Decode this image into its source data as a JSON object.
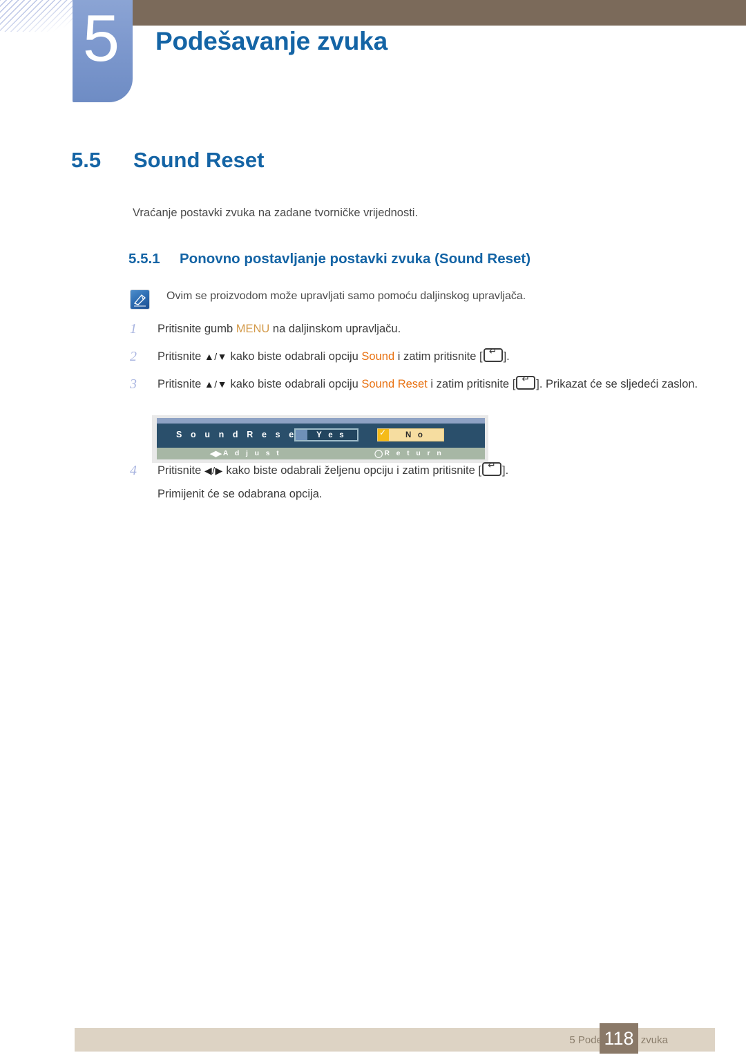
{
  "header": {
    "chapter_number": "5",
    "chapter_title": "Podešavanje zvuka"
  },
  "section": {
    "number": "5.5",
    "title": "Sound Reset",
    "description": "Vraćanje postavki zvuka na zadane tvorničke vrijednosti."
  },
  "subsection": {
    "number": "5.5.1",
    "title": "Ponovno postavljanje postavki zvuka (Sound Reset)"
  },
  "note": {
    "icon": "note-pen-icon",
    "text": "Ovim se proizvodom može upravljati samo pomoću daljinskog upravljača."
  },
  "steps": [
    {
      "number": "1",
      "parts": [
        {
          "type": "text",
          "value": "Pritisnite gumb "
        },
        {
          "type": "menu",
          "value": "MENU"
        },
        {
          "type": "text",
          "value": " na daljinskom upravljaču."
        }
      ]
    },
    {
      "number": "2",
      "parts": [
        {
          "type": "text",
          "value": "Pritisnite "
        },
        {
          "type": "arrows",
          "value": "▲/▼"
        },
        {
          "type": "text",
          "value": " kako biste odabrali opciju "
        },
        {
          "type": "keyword",
          "value": "Sound"
        },
        {
          "type": "text",
          "value": " i zatim pritisnite ["
        },
        {
          "type": "enterkey",
          "value": "enter-key-icon"
        },
        {
          "type": "text",
          "value": "]."
        }
      ]
    },
    {
      "number": "3",
      "parts": [
        {
          "type": "text",
          "value": "Pritisnite "
        },
        {
          "type": "arrows",
          "value": "▲/▼"
        },
        {
          "type": "text",
          "value": " kako biste odabrali opciju "
        },
        {
          "type": "keyword",
          "value": "Sound Reset"
        },
        {
          "type": "text",
          "value": " i zatim pritisnite ["
        },
        {
          "type": "enterkey",
          "value": "enter-key-icon"
        },
        {
          "type": "text",
          "value": "]. Prikazat će se sljedeći zaslon."
        }
      ]
    },
    {
      "number": "4",
      "parts": [
        {
          "type": "text",
          "value": "Pritisnite "
        },
        {
          "type": "arrows",
          "value": "◀/▶"
        },
        {
          "type": "text",
          "value": " kako biste odabrali željenu opciju i zatim pritisnite ["
        },
        {
          "type": "enterkey",
          "value": "enter-key-icon"
        },
        {
          "type": "text",
          "value": "]."
        }
      ],
      "sub_text": "Primijenit će se odabrana opcija."
    }
  ],
  "osd": {
    "title": "S o u n d   R e s e t",
    "title_plain": "Sound Reset",
    "options": [
      {
        "label": "Y e s",
        "label_plain": "Yes",
        "selected": false
      },
      {
        "label": "N o",
        "label_plain": "No",
        "selected": true
      }
    ],
    "footer": {
      "adjust_glyph": "◀▶",
      "adjust_label": "A d j u s t",
      "return_glyph": "◯",
      "return_label": "R e t u r n"
    }
  },
  "footer": {
    "text": "5 Podešavanje zvuka",
    "page_number": "118"
  },
  "colors": {
    "accent_blue": "#1464a5",
    "badge_blue": "#7e99ce",
    "header_brown": "#7b6a5a",
    "keyword_orange": "#e8700f",
    "menu_orange": "#d39a4a",
    "step_number": "#a8b4e0",
    "osd_body": "#2a4f6b",
    "osd_footer": "#a7b7a5",
    "osd_highlight": "#f6dda0",
    "footer_bar": "#ddd3c4",
    "footer_page": "#8a7968"
  }
}
